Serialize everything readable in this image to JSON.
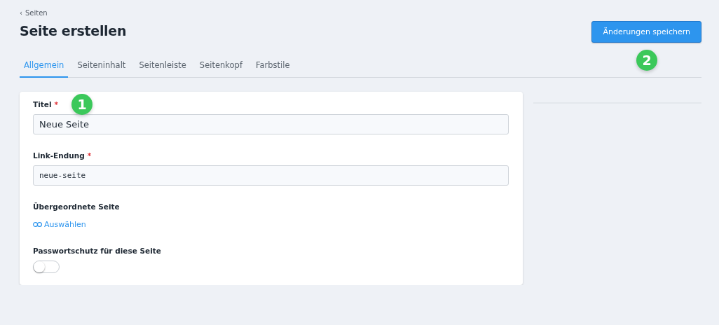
{
  "breadcrumb": {
    "icon": "‹",
    "label": "Seiten"
  },
  "title": "Seite erstellen",
  "save_button": {
    "label": "Änderungen speichern",
    "marker": "2"
  },
  "tabs": [
    {
      "label": "Allgemein",
      "selected": true
    },
    {
      "label": "Seiteninhalt",
      "selected": false
    },
    {
      "label": "Seitenleiste",
      "selected": false
    },
    {
      "label": "Seitenkopf",
      "selected": false
    },
    {
      "label": "Farbstile",
      "selected": false
    }
  ],
  "fields": [
    {
      "kind": "text",
      "label": "Titel",
      "required_mark": "*",
      "marker": "1",
      "value": "Neue Seite"
    },
    {
      "kind": "code",
      "label": "Link-Endung",
      "required_mark": "*",
      "value": "neue-seite"
    },
    {
      "kind": "link",
      "label": "Übergeordnete Seite",
      "link": "Auswählen"
    },
    {
      "kind": "toggle",
      "label": "Passwortschutz für diese Seite",
      "on": false
    }
  ]
}
